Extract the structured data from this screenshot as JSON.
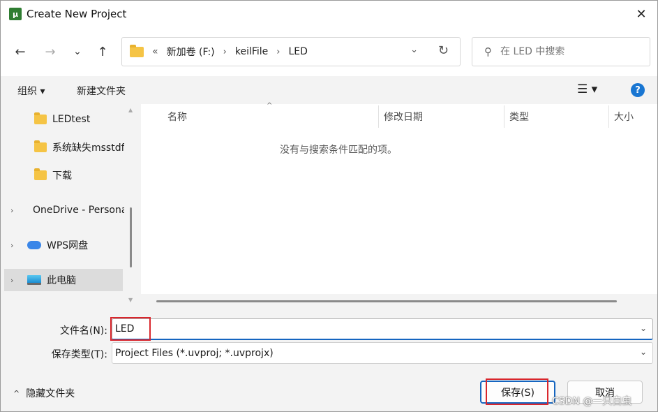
{
  "window": {
    "title": "Create New Project",
    "close_glyph": "✕"
  },
  "nav": {
    "back_glyph": "←",
    "forward_glyph": "→",
    "recent_glyph": "⌄",
    "up_glyph": "↑",
    "overflow": "«",
    "breadcrumbs": [
      "新加卷 (F:)",
      "keilFile",
      "LED"
    ],
    "separator": "›",
    "dropdown_glyph": "⌄",
    "refresh_glyph": "↻",
    "search_placeholder": "在 LED 中搜索",
    "search_icon": "⚲"
  },
  "toolbar": {
    "organize_label": "组织 ▾",
    "new_folder_label": "新建文件夹",
    "view_glyph": "☰ ▾",
    "help_glyph": "?"
  },
  "sidebar": {
    "items": [
      {
        "label": "LEDtest",
        "icon": "folder-icon",
        "expander": ""
      },
      {
        "label": "系统缺失msstdf",
        "icon": "folder-icon",
        "expander": ""
      },
      {
        "label": "下载",
        "icon": "folder-icon",
        "expander": ""
      },
      {
        "label": "OneDrive - Personal",
        "icon": "onedrive-icon",
        "expander": "›"
      },
      {
        "label": "WPS网盘",
        "icon": "wps-cloud-icon",
        "expander": "›"
      },
      {
        "label": "此电脑",
        "icon": "computer-icon",
        "expander": "›"
      }
    ],
    "scroll_up": "▲",
    "scroll_down": "▼"
  },
  "content": {
    "columns": [
      "名称",
      "修改日期",
      "类型",
      "大小"
    ],
    "sort_glyph": "^",
    "empty_message": "没有与搜索条件匹配的项。"
  },
  "form": {
    "filename_label": "文件名(N):",
    "filename_value": "LED",
    "filetype_label": "保存类型(T):",
    "filetype_value": "Project Files (*.uvproj; *.uvprojx)",
    "chevron": "⌄"
  },
  "footer": {
    "hide_folders_caret": "^",
    "hide_folders_label": "隐藏文件夹",
    "save_label": "保存(S)",
    "cancel_label": "取消",
    "watermark": "CSDN @一只白虫"
  },
  "colors": {
    "accent": "#1565c0",
    "highlight_box": "#d9262c",
    "folder": "#f5c445"
  }
}
